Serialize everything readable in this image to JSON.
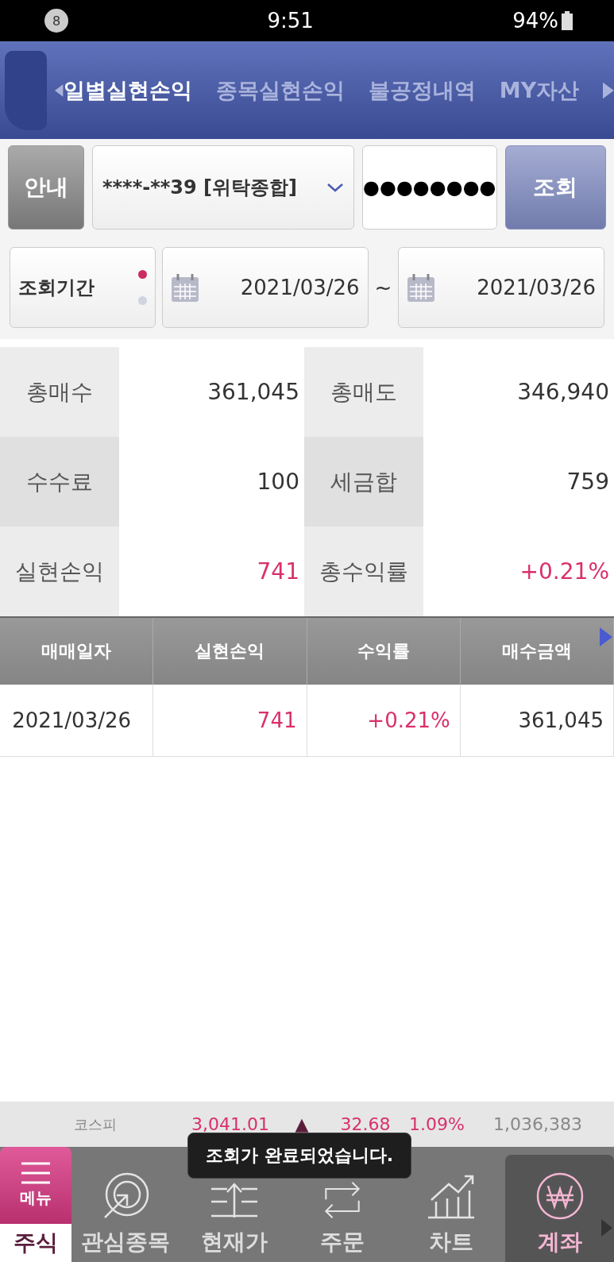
{
  "status_bar": {
    "notification_count": "8",
    "time": "9:51",
    "battery": "94%"
  },
  "tabs": [
    {
      "label": "일별실현손익",
      "selected": true
    },
    {
      "label": "종목실현손익",
      "selected": false
    },
    {
      "label": "불공정내역",
      "selected": false
    },
    {
      "label": "MY자산",
      "selected": false
    }
  ],
  "account": {
    "info_button": "안내",
    "account_number": "****-**39 [위탁종합]",
    "password": "●●●●●●●●",
    "search_button": "조회"
  },
  "period": {
    "label": "조회기간",
    "dots": [
      {
        "selected": true
      },
      {
        "selected": false
      }
    ],
    "start_date": "2021/03/26",
    "separator": "~",
    "end_date": "2021/03/26"
  },
  "summary": [
    {
      "label": "총매수",
      "value": "361,045",
      "highlight": false
    },
    {
      "label": "총매도",
      "value": "346,940",
      "highlight": false
    },
    {
      "label": "수수료",
      "value": "100",
      "highlight": false
    },
    {
      "label": "세금합",
      "value": "759",
      "highlight": false
    },
    {
      "label": "실현손익",
      "value": "741",
      "highlight": true
    },
    {
      "label": "총수익률",
      "value": "+0.21%",
      "highlight": true
    }
  ],
  "table": {
    "columns": [
      "매매일자",
      "실현손익",
      "수익률",
      "매수금액"
    ],
    "rows": [
      {
        "cells": [
          {
            "text": "2021/03/26",
            "highlight": false
          },
          {
            "text": "741",
            "highlight": true
          },
          {
            "text": "+0.21%",
            "highlight": true
          },
          {
            "text": "361,045",
            "highlight": false
          }
        ]
      }
    ]
  },
  "ticker": {
    "name": "코스피",
    "value": "3,041.01",
    "arrow": "▲",
    "change": "32.68",
    "rate": "1.09%",
    "volume": "1,036,383"
  },
  "toast": "조회가 완료되었습니다.",
  "bottom_nav": [
    {
      "kind": "menu",
      "icon_label": "메뉴",
      "label": "주식"
    },
    {
      "kind": "watch",
      "label": "관심종목",
      "selected": false
    },
    {
      "kind": "price",
      "label": "현재가",
      "selected": false
    },
    {
      "kind": "order",
      "label": "주문",
      "selected": false
    },
    {
      "kind": "chart",
      "label": "차트",
      "selected": false
    },
    {
      "kind": "account",
      "label": "계좌",
      "selected": true
    }
  ]
}
